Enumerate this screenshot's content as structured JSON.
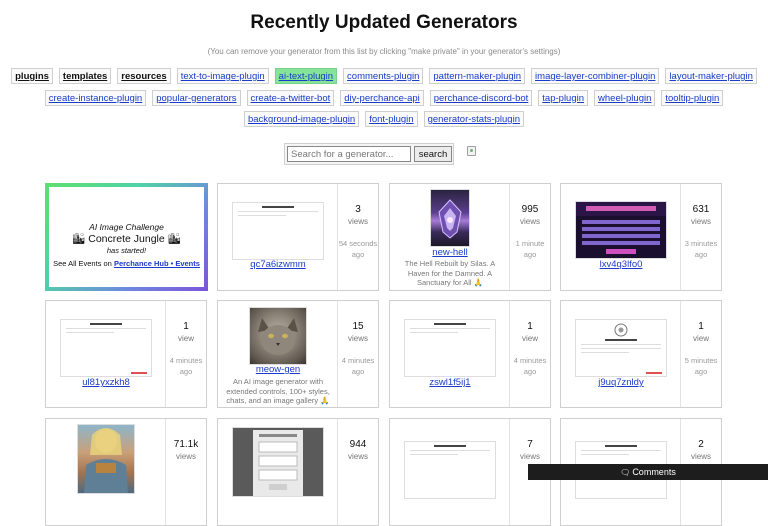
{
  "page": {
    "title": "Recently Updated Generators",
    "subtitle": "(You can remove your generator from this list by clicking \"make private\" in your generator's settings)"
  },
  "chips": [
    [
      {
        "label": "plugins",
        "style": "bold"
      },
      {
        "label": "templates",
        "style": "bold"
      },
      {
        "label": "resources",
        "style": "bold"
      },
      {
        "label": "text-to-image-plugin",
        "style": "link"
      },
      {
        "label": "ai-text-plugin",
        "style": "green"
      },
      {
        "label": "comments-plugin",
        "style": "link"
      },
      {
        "label": "pattern-maker-plugin",
        "style": "link"
      },
      {
        "label": "image-layer-combiner-plugin",
        "style": "link"
      },
      {
        "label": "layout-maker-plugin",
        "style": "link"
      }
    ],
    [
      {
        "label": "create-instance-plugin",
        "style": "link"
      },
      {
        "label": "popular-generators",
        "style": "link"
      },
      {
        "label": "create-a-twitter-bot",
        "style": "link"
      },
      {
        "label": "diy-perchance-api",
        "style": "link"
      },
      {
        "label": "perchance-discord-bot",
        "style": "link"
      },
      {
        "label": "tap-plugin",
        "style": "link"
      },
      {
        "label": "wheel-plugin",
        "style": "link"
      },
      {
        "label": "tooltip-plugin",
        "style": "link"
      }
    ],
    [
      {
        "label": "background-image-plugin",
        "style": "link"
      },
      {
        "label": "font-plugin",
        "style": "link"
      },
      {
        "label": "generator-stats-plugin",
        "style": "link"
      }
    ]
  ],
  "search": {
    "placeholder": "Search for a generator...",
    "button_label": "search"
  },
  "featured": {
    "line1": "AI Image Challenge",
    "line2": "🏙 Concrete Jungle 🏙",
    "line3": "has started!",
    "line4_prefix": "See All Events on ",
    "line4_link": "Perchance Hub • Events"
  },
  "cards": [
    {
      "name": "qc7a6izwmm",
      "views": "3",
      "views_label": "views",
      "ago": "54 seconds ago",
      "thumb": "doc"
    },
    {
      "name": "new-hell",
      "views": "995",
      "views_label": "views",
      "ago": "1 minute ago",
      "thumb": "hell",
      "desc": "The Hell Rebuilt by Silas. A Haven for the Damned. A Sanctuary for All 🙏"
    },
    {
      "name": "lxv4q3lfo0",
      "views": "631",
      "views_label": "views",
      "ago": "3 minutes ago",
      "thumb": "neon"
    },
    {
      "name": "ul81yxzkh8",
      "views": "1",
      "views_label": "view",
      "ago": "4 minutes ago",
      "thumb": "doc"
    },
    {
      "name": "meow-gen",
      "views": "15",
      "views_label": "views",
      "ago": "4 minutes ago",
      "thumb": "cat",
      "desc": "An AI image generator with extended controls, 100+ styles, chats, and an image gallery 🙏"
    },
    {
      "name": "zswl1f5ij1",
      "views": "1",
      "views_label": "view",
      "ago": "4 minutes ago",
      "thumb": "doc"
    },
    {
      "name": "j9uq7znldy",
      "views": "1",
      "views_label": "view",
      "ago": "5 minutes ago",
      "thumb": "doc2"
    },
    {
      "name": "",
      "views": "71.1k",
      "views_label": "views",
      "ago": "",
      "thumb": "armor"
    },
    {
      "name": "",
      "views": "944",
      "views_label": "views",
      "ago": "",
      "thumb": "form"
    },
    {
      "name": "",
      "views": "7",
      "views_label": "views",
      "ago": "",
      "thumb": "doc"
    },
    {
      "name": "",
      "views": "2",
      "views_label": "views",
      "ago": "",
      "thumb": "doc"
    }
  ],
  "comments": {
    "icon": "chat-icon",
    "label": "Comments"
  },
  "colors": {
    "link": "#1a3cc9",
    "chip_green": "#86e39a",
    "featured_gradient_start": "#5fe06a",
    "featured_gradient_end": "#7b55d8",
    "comments_bar": "#1d1d1d"
  }
}
